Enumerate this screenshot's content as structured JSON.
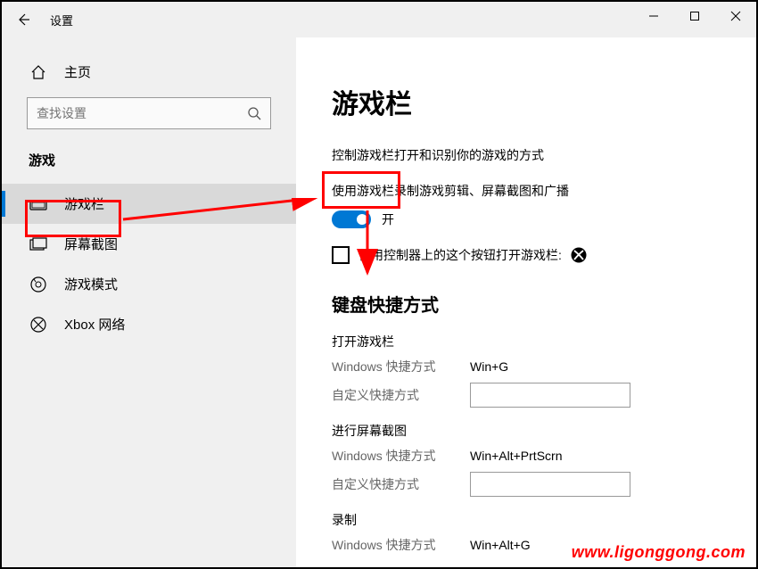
{
  "window": {
    "title": "设置"
  },
  "sidebar": {
    "home_label": "主页",
    "search_placeholder": "查找设置",
    "section_label": "游戏",
    "items": [
      {
        "label": "游戏栏",
        "active": true
      },
      {
        "label": "屏幕截图",
        "active": false
      },
      {
        "label": "游戏模式",
        "active": false
      },
      {
        "label": "Xbox 网络",
        "active": false
      }
    ]
  },
  "content": {
    "title": "游戏栏",
    "description": "控制游戏栏打开和识别你的游戏的方式",
    "toggle_desc": "使用游戏栏录制游戏剪辑、屏幕截图和广播",
    "toggle_state_label": "开",
    "checkbox_label": "使用控制器上的这个按钮打开游戏栏:",
    "shortcuts_heading": "键盘快捷方式",
    "win_shortcut_label": "Windows 快捷方式",
    "custom_shortcut_label": "自定义快捷方式",
    "groups": [
      {
        "name": "打开游戏栏",
        "win_value": "Win+G"
      },
      {
        "name": "进行屏幕截图",
        "win_value": "Win+Alt+PrtScrn"
      },
      {
        "name": "录制",
        "win_value": "Win+Alt+G"
      }
    ]
  },
  "watermark": "www.ligonggong.com"
}
